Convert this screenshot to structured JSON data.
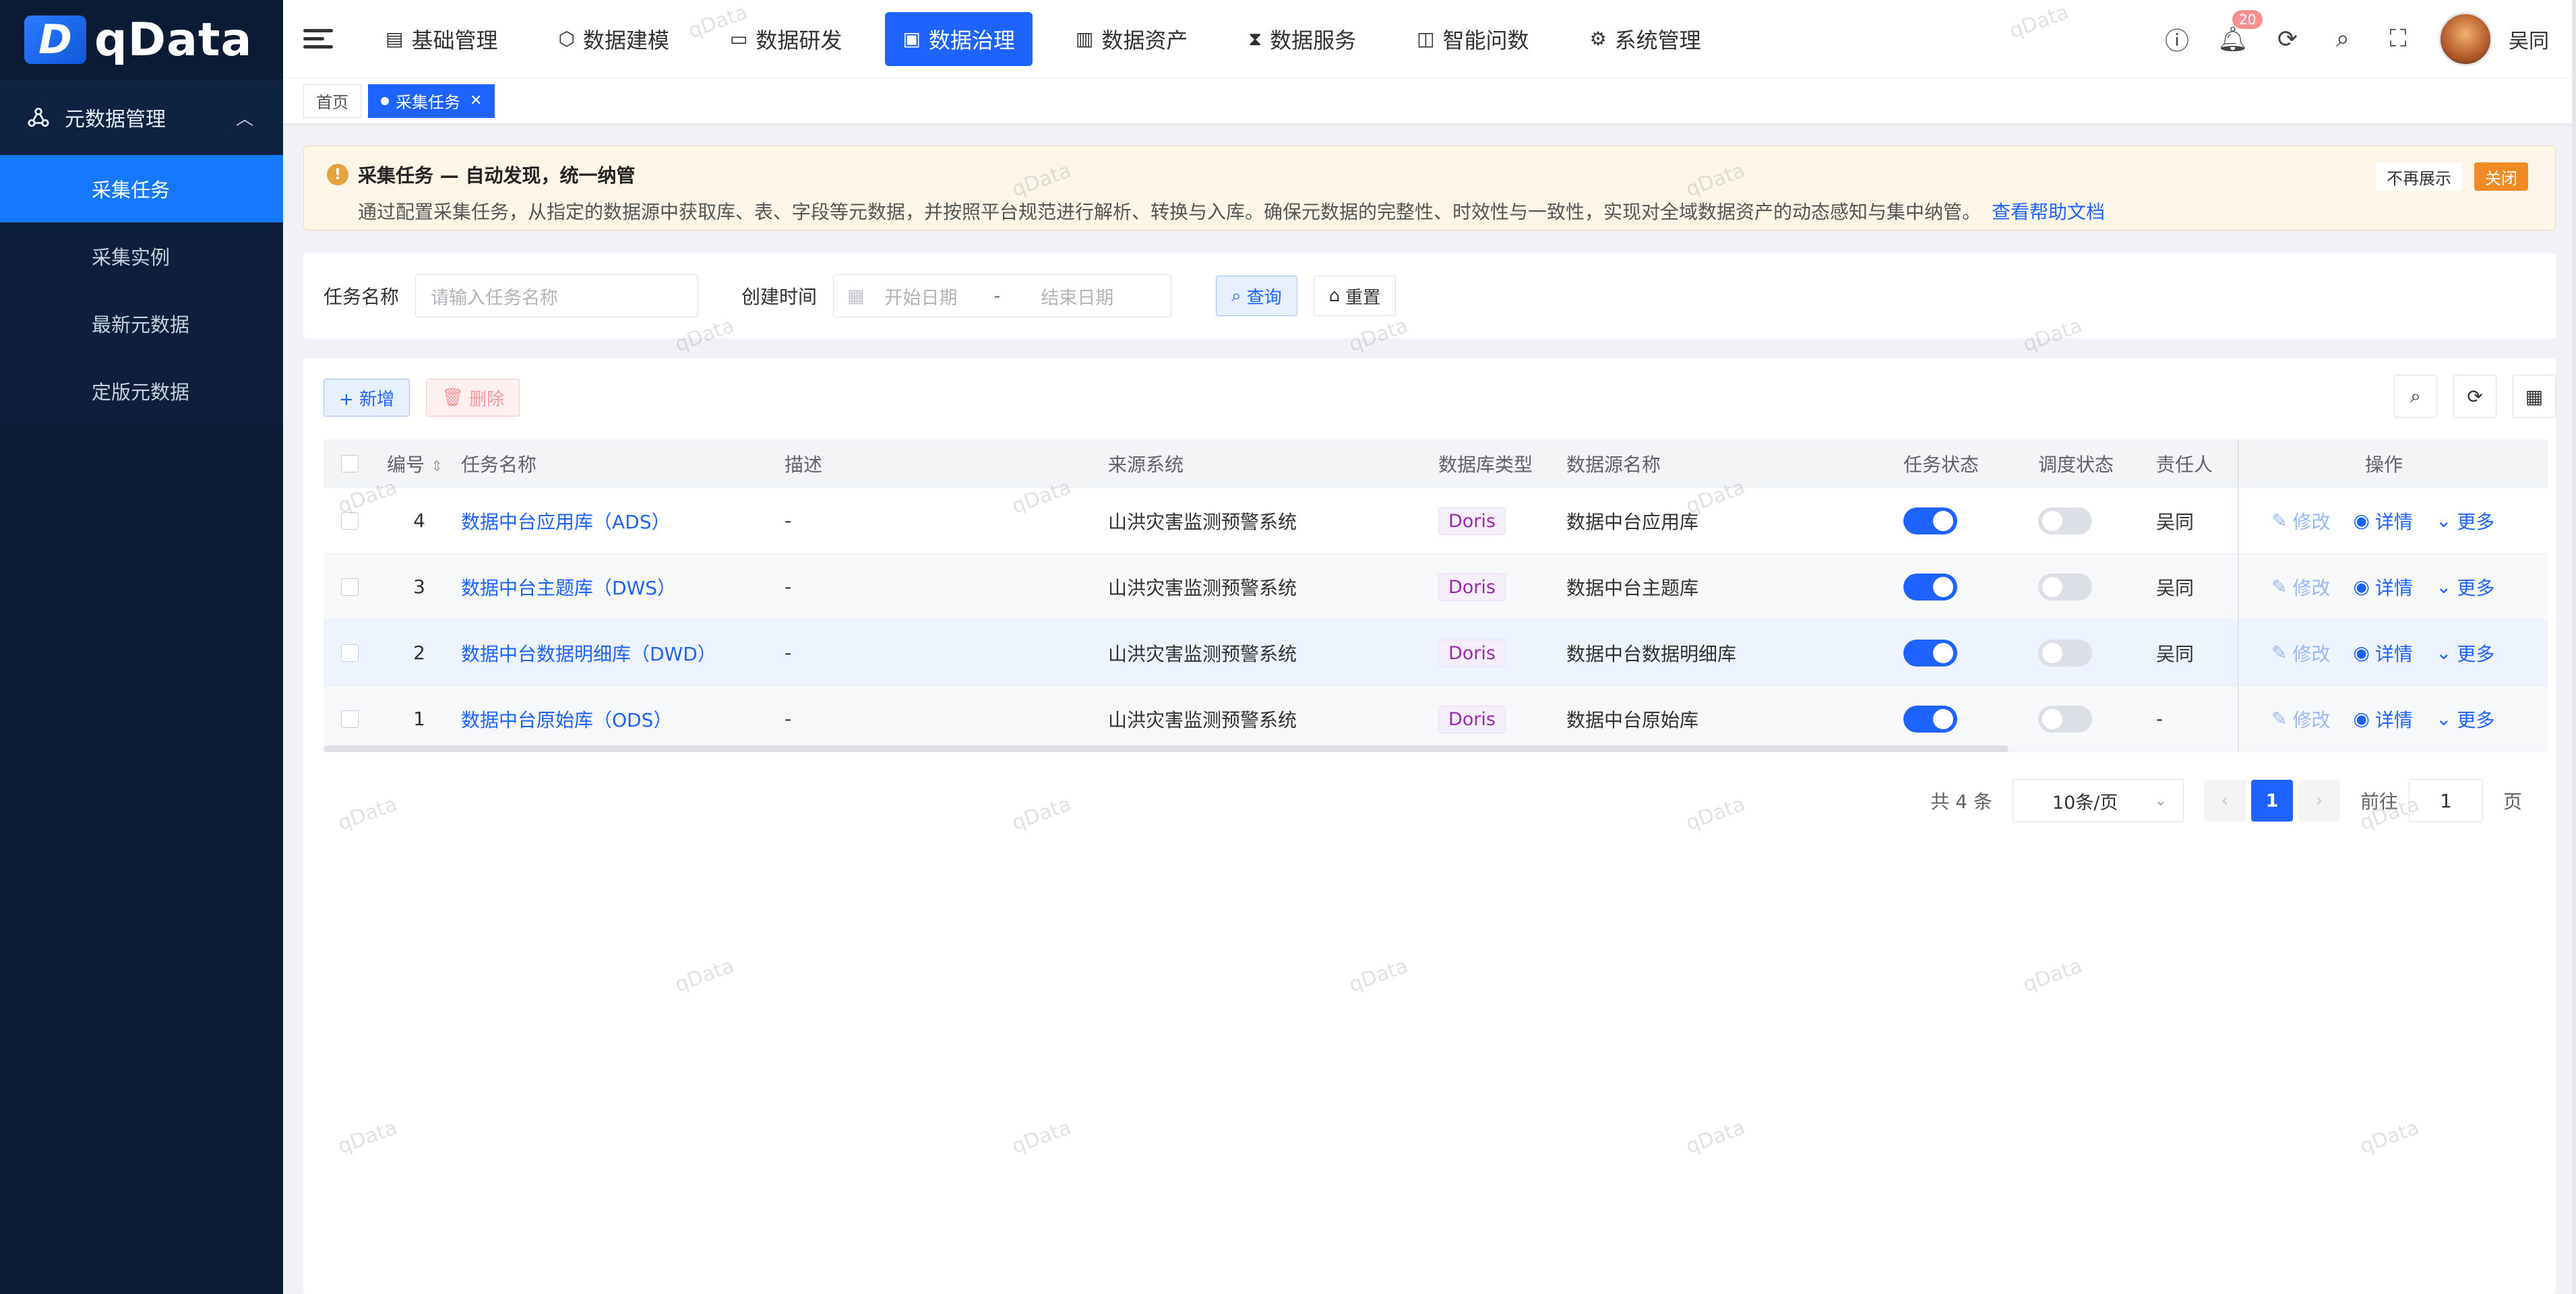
{
  "app": {
    "logo_text": "qData"
  },
  "sidebar": {
    "group_label": "元数据管理",
    "items": [
      {
        "label": "采集任务",
        "active": true
      },
      {
        "label": "采集实例"
      },
      {
        "label": "最新元数据"
      },
      {
        "label": "定版元数据"
      }
    ]
  },
  "topnav": {
    "items": [
      {
        "label": "基础管理",
        "icon": "grid-icon"
      },
      {
        "label": "数据建模",
        "icon": "cube-icon"
      },
      {
        "label": "数据研发",
        "icon": "window-icon"
      },
      {
        "label": "数据治理",
        "icon": "governance-icon",
        "active": true
      },
      {
        "label": "数据资产",
        "icon": "asset-icon"
      },
      {
        "label": "数据服务",
        "icon": "hourglass-icon"
      },
      {
        "label": "智能问数",
        "icon": "chart-icon"
      },
      {
        "label": "系统管理",
        "icon": "gear-icon"
      }
    ],
    "notification_count": "20",
    "username": "吴同"
  },
  "tabs": [
    {
      "label": "首页"
    },
    {
      "label": "采集任务",
      "active": true
    }
  ],
  "notice": {
    "title": "采集任务 — 自动发现，统一纳管",
    "desc": "通过配置采集任务，从指定的数据源中获取库、表、字段等元数据，并按照平台规范进行解析、转换与入库。确保元数据的完整性、时效性与一致性，实现对全域数据资产的动态感知与集中纳管。",
    "link": "查看帮助文档",
    "dismiss": "不再展示",
    "close": "关闭"
  },
  "search": {
    "name_label": "任务名称",
    "name_placeholder": "请输入任务名称",
    "time_label": "创建时间",
    "start_placeholder": "开始日期",
    "sep": "-",
    "end_placeholder": "结束日期",
    "query": "查询",
    "reset": "重置"
  },
  "toolbar": {
    "add": "+ 新增",
    "delete": "删除"
  },
  "table": {
    "columns": [
      "编号",
      "任务名称",
      "描述",
      "来源系统",
      "数据库类型",
      "数据源名称",
      "任务状态",
      "调度状态",
      "责任人",
      "操作"
    ],
    "rows": [
      {
        "id": "4",
        "name": "数据中台应用库（ADS）",
        "desc": "-",
        "source": "山洪灾害监测预警系统",
        "dbtype": "Doris",
        "ds": "数据中台应用库",
        "task_on": true,
        "sched_on": false,
        "owner": "吴同"
      },
      {
        "id": "3",
        "name": "数据中台主题库（DWS）",
        "desc": "-",
        "source": "山洪灾害监测预警系统",
        "dbtype": "Doris",
        "ds": "数据中台主题库",
        "task_on": true,
        "sched_on": false,
        "owner": "吴同"
      },
      {
        "id": "2",
        "name": "数据中台数据明细库（DWD）",
        "desc": "-",
        "source": "山洪灾害监测预警系统",
        "dbtype": "Doris",
        "ds": "数据中台数据明细库",
        "task_on": true,
        "sched_on": false,
        "owner": "吴同"
      },
      {
        "id": "1",
        "name": "数据中台原始库（ODS）",
        "desc": "-",
        "source": "山洪灾害监测预警系统",
        "dbtype": "Doris",
        "ds": "数据中台原始库",
        "task_on": true,
        "sched_on": false,
        "owner": "-"
      }
    ],
    "ops": {
      "edit": "修改",
      "detail": "详情",
      "more": "更多"
    }
  },
  "pager": {
    "total": "共 4 条",
    "page_size": "10条/页",
    "current": "1",
    "goto_label": "前往",
    "goto_value": "1",
    "page_suffix": "页"
  },
  "watermark": "qData",
  "colors": {
    "primary": "#1e63ff",
    "sidebar_bg": "#0b1b34",
    "warning": "#f08a24"
  }
}
